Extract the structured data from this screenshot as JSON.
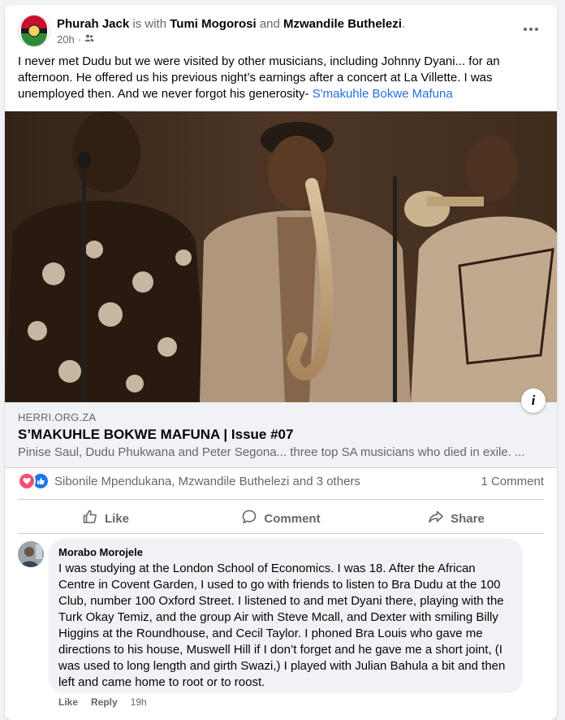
{
  "post": {
    "author": "Phurah Jack",
    "with_word": "is with",
    "tagged_1": "Tumi Mogorosi",
    "and_word": "and",
    "tagged_2": "Mzwandile Buthelezi",
    "time": "20h",
    "separator": "·",
    "audience_icon": "friends-icon",
    "text": "I never met Dudu but we were visited by other musicians, including Johnny Dyani... for an afternoon. He offered us his previous night’s earnings after a concert at La Villette. I was unemployed then. And we never forgot his generosity-",
    "text_link": "S'makuhle Bokwe Mafuna"
  },
  "link_preview": {
    "domain": "HERRI.ORG.ZA",
    "title": "S’MAKUHLE BOKWE MAFUNA | Issue #07",
    "description": "Pinise Saul, Dudu Phukwana and Peter Segona... three top SA musicians who died in exile. ...",
    "info_glyph": "i"
  },
  "reactions": {
    "names": "Sibonile Mpendukana, Mzwandile Buthelezi and 3 others",
    "comment_count": "1 Comment"
  },
  "actions": {
    "like": "Like",
    "comment": "Comment",
    "share": "Share"
  },
  "comment": {
    "author": "Morabo Morojele",
    "text": "I was studying at the London School of Economics. I was 18. After the African Centre in Covent Garden, I used to go with friends to listen to Bra Dudu at the 100 Club, number 100 Oxford Street. I listened to and met Dyani there, playing with the Turk Okay Temiz, and the group Air with Steve Mcall, and Dexter with smiling Billy Higgins at the Roundhouse, and Cecil Taylor. I phoned Bra Louis who gave me directions to his house, Muswell Hill if I don’t forget and he gave me a short joint, (I was used to long length and girth Swazi,) I played with Julian Bahula a bit and then left and came home to root or to roost.",
    "like": "Like",
    "reply": "Reply",
    "time": "19h"
  },
  "colors": {
    "link": "#216fdb",
    "secondary_text": "#65676b",
    "background": "#f0f2f5",
    "love": "#f0506e",
    "like": "#1877f2"
  }
}
